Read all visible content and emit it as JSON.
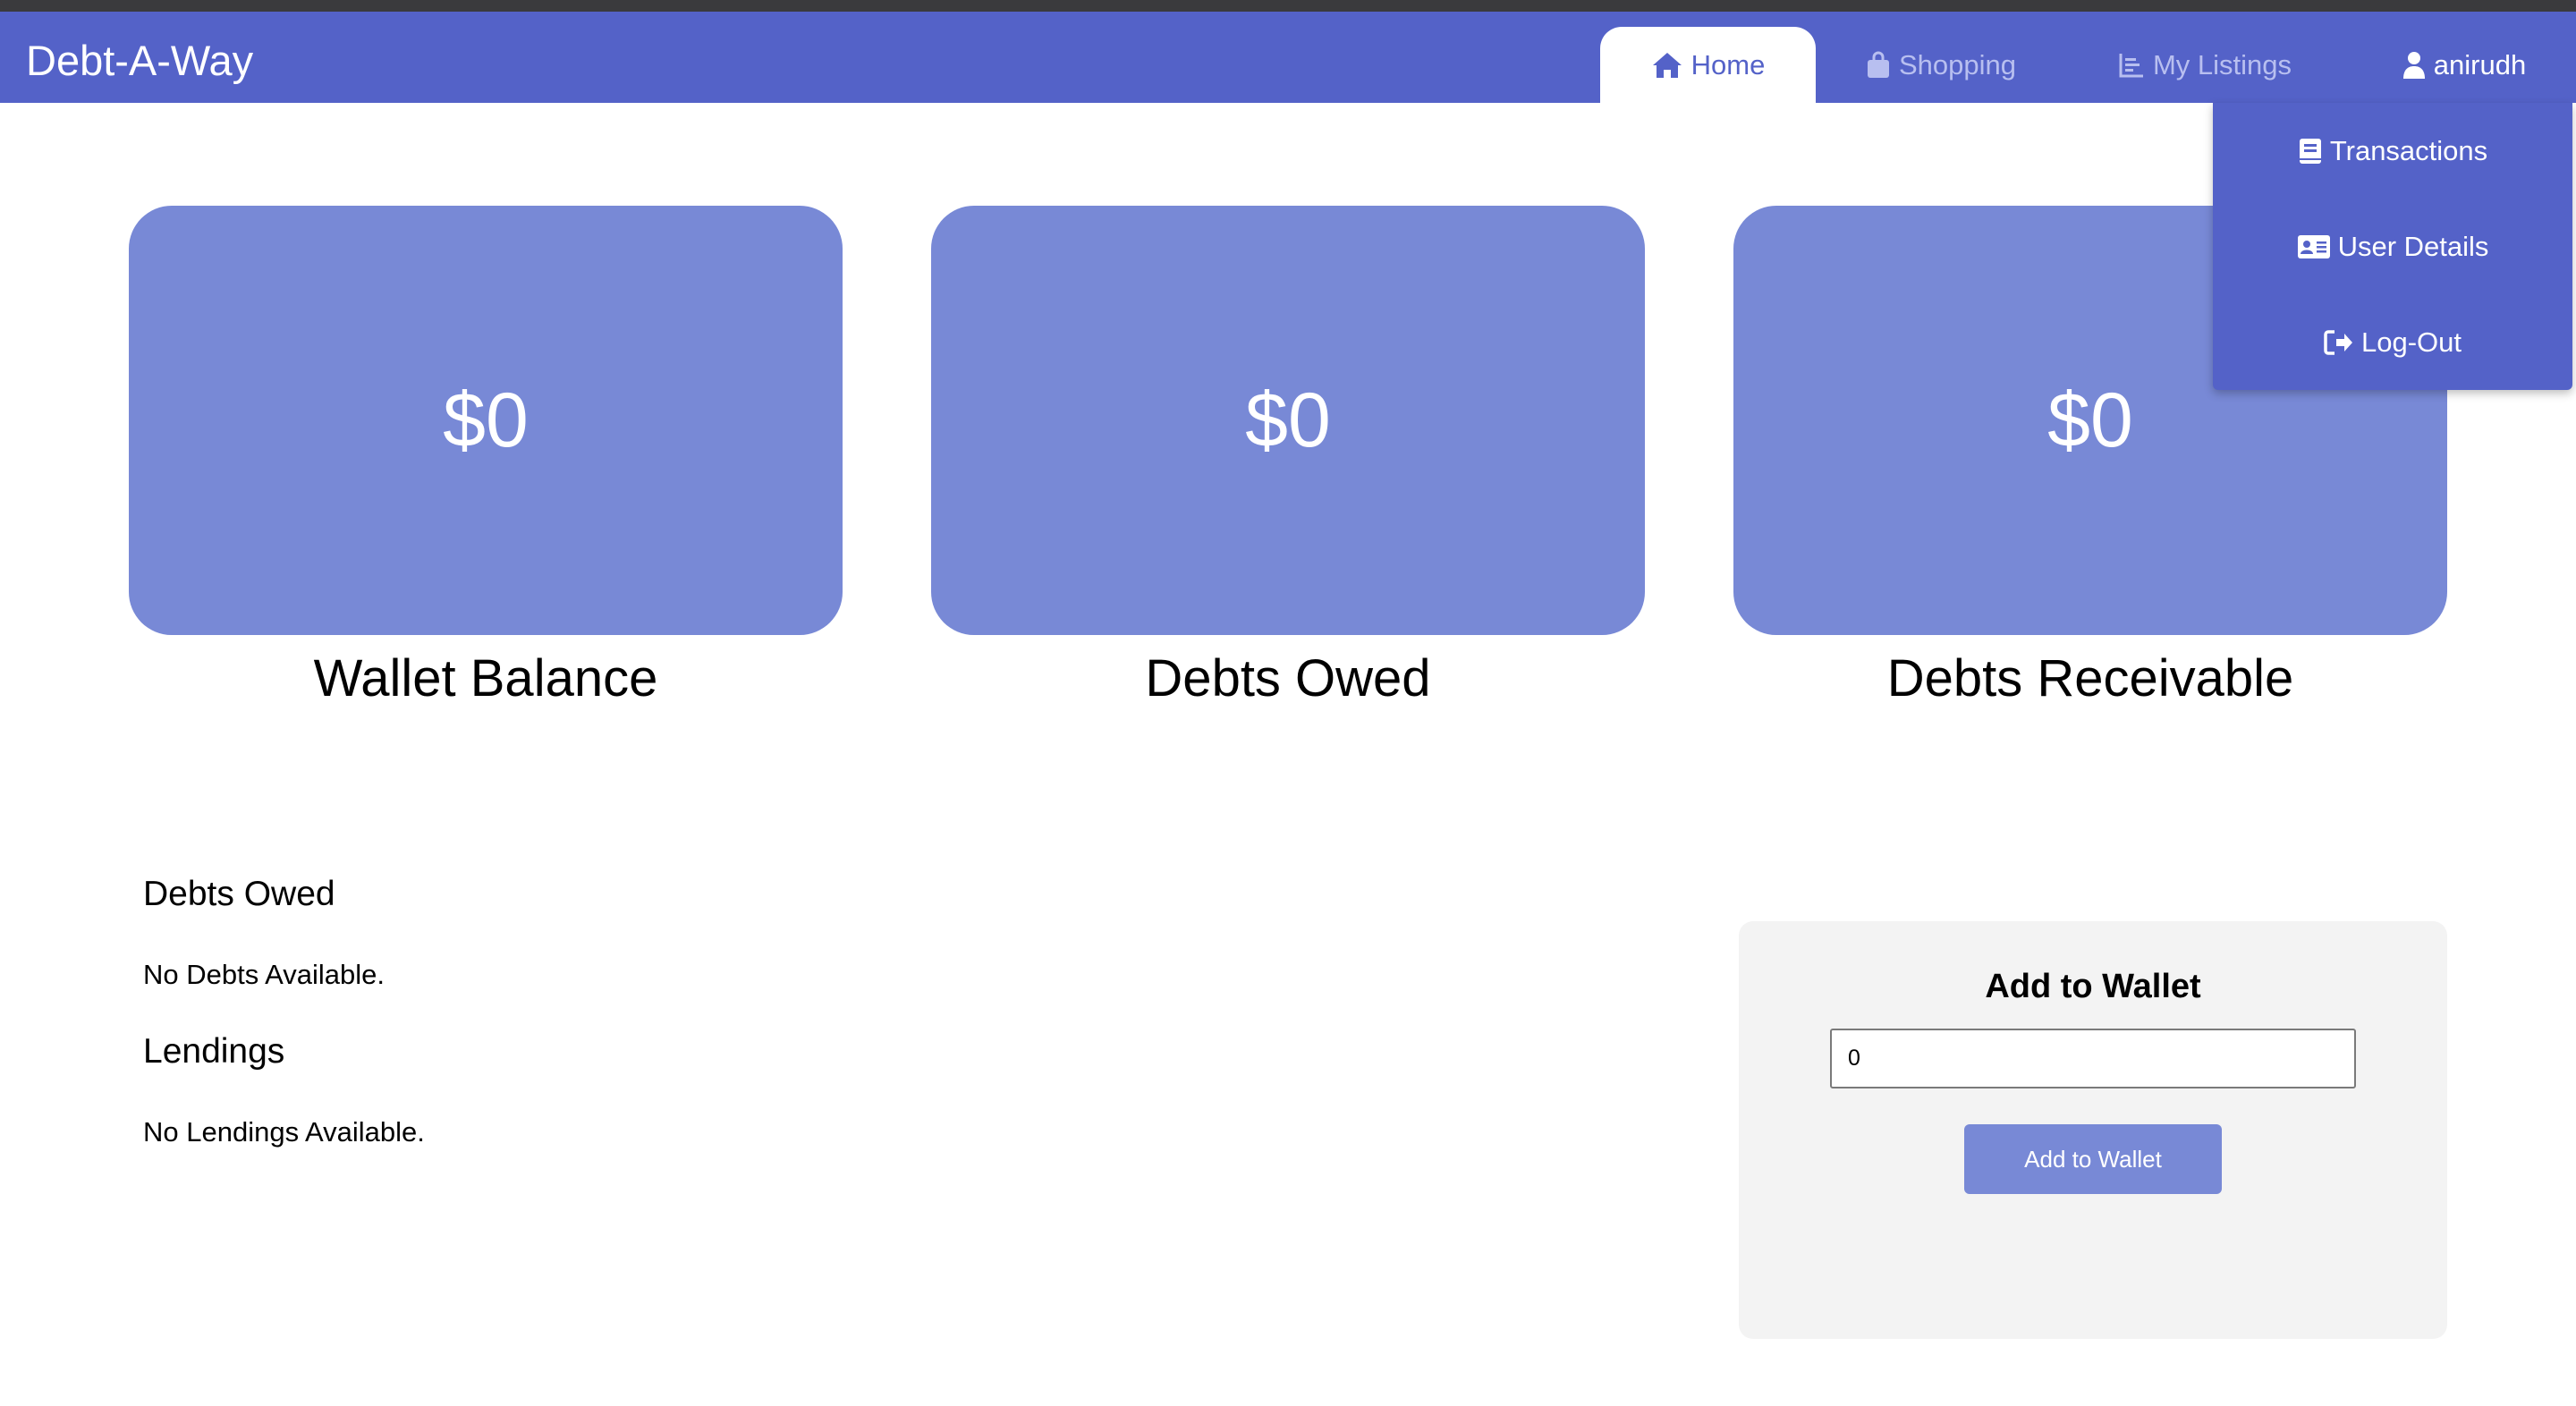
{
  "app": {
    "brand": "Debt-A-Way"
  },
  "nav": {
    "home": "Home",
    "shopping": "Shopping",
    "my_listings": "My Listings",
    "user": "anirudh"
  },
  "user_menu": {
    "transactions": "Transactions",
    "user_details": "User Details",
    "logout": "Log-Out"
  },
  "stats": {
    "wallet_balance": {
      "value": "$0",
      "label": "Wallet Balance"
    },
    "debts_owed": {
      "value": "$0",
      "label": "Debts Owed"
    },
    "debts_receivable": {
      "value": "$0",
      "label": "Debts Receivable"
    }
  },
  "debts_section": {
    "heading": "Debts Owed",
    "empty_text": "No Debts Available."
  },
  "lendings_section": {
    "heading": "Lendings",
    "empty_text": "No Lendings Available."
  },
  "wallet": {
    "title": "Add to Wallet",
    "amount_value": "0",
    "button_label": "Add to Wallet"
  },
  "colors": {
    "navbar": "#5462c8",
    "card": "#7889d6",
    "panel": "#f3f3f3"
  },
  "icons": {
    "home": "home-icon",
    "shopping": "shopping-bag-icon",
    "listings": "chart-icon",
    "user": "user-icon",
    "transactions": "book-icon",
    "user_details": "id-card-icon",
    "logout": "logout-icon"
  }
}
